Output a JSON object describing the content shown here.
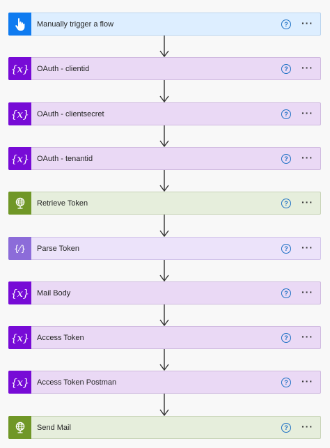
{
  "steps": [
    {
      "id": "manually-trigger-a-flow",
      "label": "Manually trigger a flow",
      "kind": "trigger",
      "icon": "touch-hand-icon",
      "help": "?",
      "more": "···"
    },
    {
      "id": "oauth-clientid",
      "label": "OAuth - clientid",
      "kind": "variable",
      "icon": "variable-icon",
      "icon_text": "{x}",
      "help": "?",
      "more": "···"
    },
    {
      "id": "oauth-clientsecret",
      "label": "OAuth - clientsecret",
      "kind": "variable",
      "icon": "variable-icon",
      "icon_text": "{x}",
      "help": "?",
      "more": "···"
    },
    {
      "id": "oauth-tenantid",
      "label": "OAuth - tenantid",
      "kind": "variable",
      "icon": "variable-icon",
      "icon_text": "{x}",
      "help": "?",
      "more": "···"
    },
    {
      "id": "retrieve-token",
      "label": "Retrieve Token",
      "kind": "http",
      "icon": "globe-icon",
      "help": "?",
      "more": "···"
    },
    {
      "id": "parse-token",
      "label": "Parse Token",
      "kind": "parse",
      "icon": "parse-json-icon",
      "icon_text": "{⁄}",
      "help": "?",
      "more": "···"
    },
    {
      "id": "mail-body",
      "label": "Mail Body",
      "kind": "variable",
      "icon": "variable-icon",
      "icon_text": "{x}",
      "help": "?",
      "more": "···"
    },
    {
      "id": "access-token",
      "label": "Access Token",
      "kind": "variable",
      "icon": "variable-icon",
      "icon_text": "{x}",
      "help": "?",
      "more": "···"
    },
    {
      "id": "access-token-postman",
      "label": "Access Token Postman",
      "kind": "variable",
      "icon": "variable-icon",
      "icon_text": "{x}",
      "help": "?",
      "more": "···"
    },
    {
      "id": "send-mail",
      "label": "Send Mail",
      "kind": "http",
      "icon": "globe-icon",
      "help": "?",
      "more": "···"
    }
  ],
  "colors": {
    "trigger_bg": "#ddeeff",
    "trigger_icon": "#0f7bf0",
    "variable_bg": "#ead9f5",
    "variable_icon": "#770bd6",
    "http_bg": "#e6eedc",
    "http_icon": "#709727",
    "parse_bg": "#ece3fa",
    "parse_icon": "#8c6cd9",
    "help_icon": "#1a6fc4"
  }
}
